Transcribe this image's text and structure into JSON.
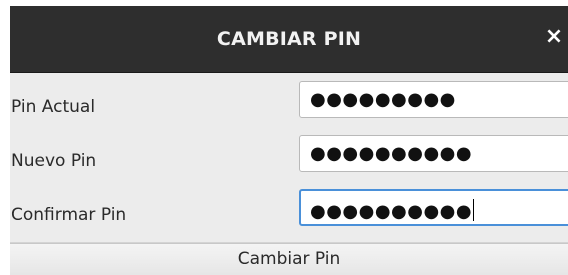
{
  "dialog": {
    "title": "CAMBIAR PIN",
    "close_icon": "close-icon",
    "close_glyph": "×"
  },
  "form": {
    "fields": [
      {
        "label": "Pin Actual",
        "value": "●●●●●●●●●",
        "focused": false
      },
      {
        "label": "Nuevo Pin",
        "value": "●●●●●●●●●●",
        "focused": false
      },
      {
        "label": "Confirmar Pin",
        "value": "●●●●●●●●●●",
        "focused": true
      }
    ],
    "submit_label": "Cambiar Pin"
  },
  "colors": {
    "titlebar": "#2e2e2e",
    "background": "#ececec",
    "focus_border": "#4a90d9"
  }
}
